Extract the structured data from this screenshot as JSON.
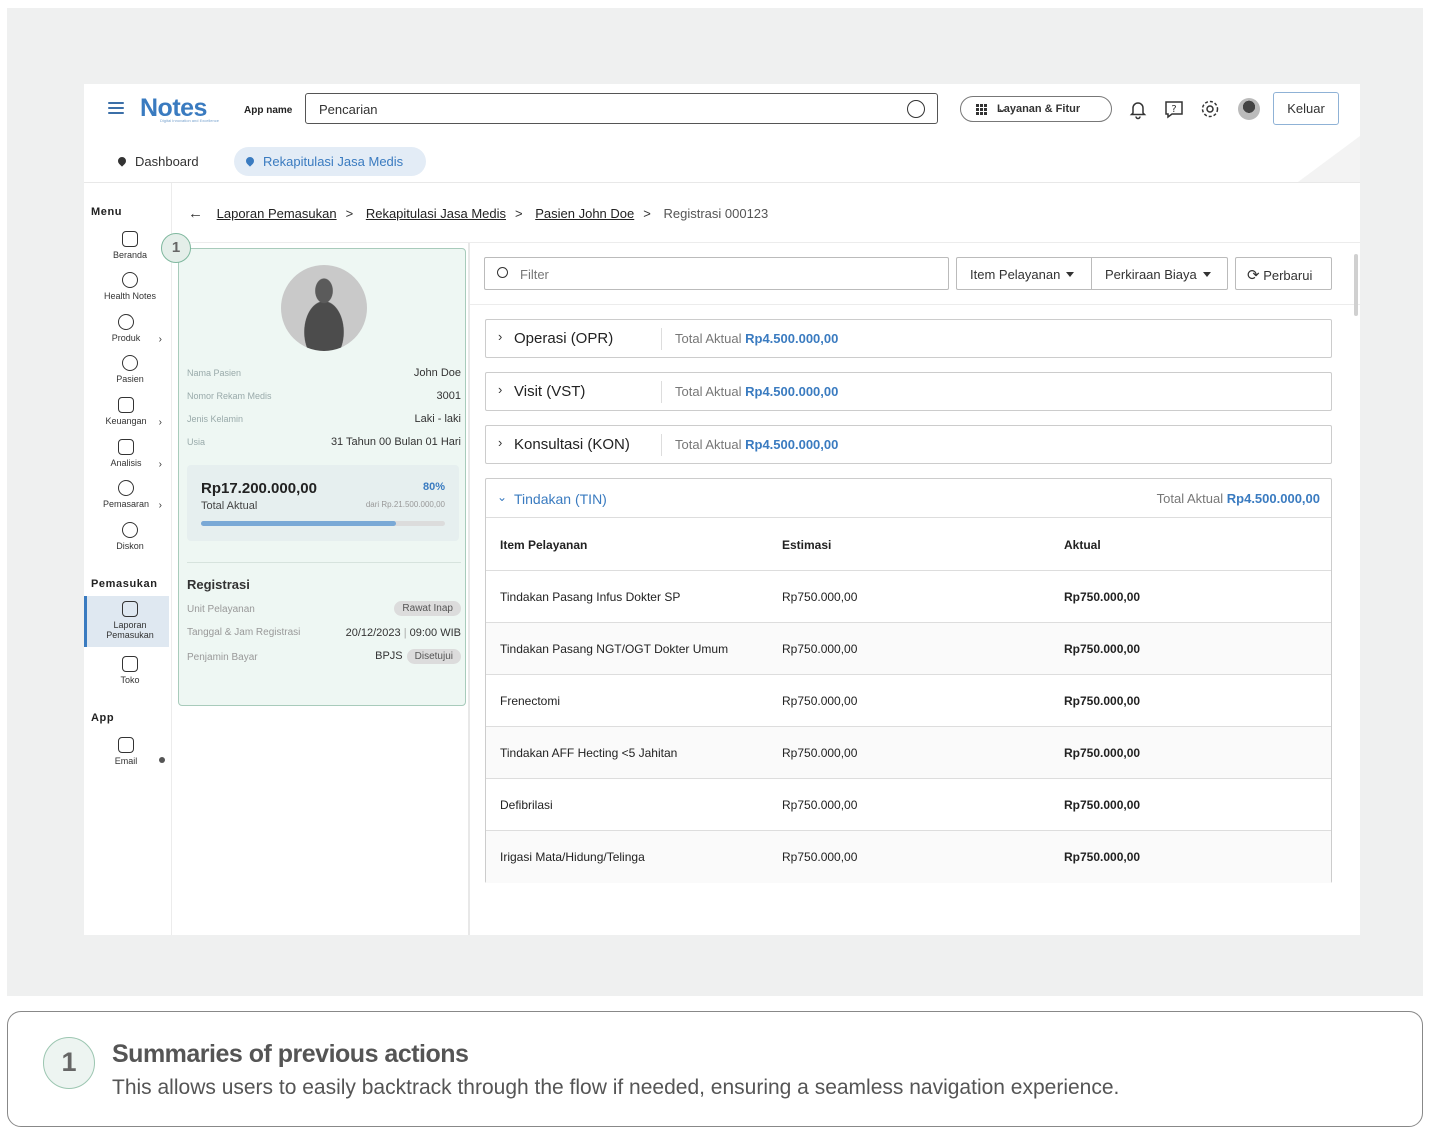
{
  "header": {
    "logo": "Notes",
    "logo_tagline": "Digital Innovation and Excellence",
    "app_name": "App name",
    "search_text": "Pencarian",
    "services_label": "Layanan & Fitur",
    "logout_label": "Keluar",
    "icons": [
      "menu-icon",
      "bell-icon",
      "help-icon",
      "gear-icon",
      "avatar"
    ]
  },
  "tabs": {
    "dashboard": "Dashboard",
    "active": "Rekapitulasi Jasa Medis"
  },
  "sidebar": {
    "menu_title": "Menu",
    "menu_items": [
      {
        "label": "Beranda",
        "icon": "home-icon"
      },
      {
        "label": "Health Notes",
        "icon": "notes-icon"
      },
      {
        "label": "Produk",
        "icon": "product-icon",
        "has_arrow": true
      },
      {
        "label": "Pasien",
        "icon": "user-icon"
      },
      {
        "label": "Keuangan",
        "icon": "wallet-icon",
        "has_arrow": true
      },
      {
        "label": "Analisis",
        "icon": "chart-icon",
        "has_arrow": true
      },
      {
        "label": "Pemasaran",
        "icon": "network-icon",
        "has_arrow": true
      },
      {
        "label": "Diskon",
        "icon": "discount-icon"
      }
    ],
    "income_title": "Pemasukan",
    "income_items": [
      {
        "label_1": "Laporan",
        "label_2": "Pemasukan",
        "icon": "report-icon",
        "active": true
      },
      {
        "label": "Toko",
        "icon": "store-icon"
      }
    ],
    "app_title": "App",
    "app_items": [
      {
        "label": "Email",
        "icon": "mail-icon",
        "arrow": "●"
      }
    ],
    "arrow": "›"
  },
  "breadcrumb": {
    "items": [
      "Laporan Pemasukan",
      "Rekapitulasi Jasa Medis",
      "Pasien John Doe"
    ],
    "current": "Registrasi 000123",
    "separator": ">"
  },
  "patient": {
    "step_badge": "1",
    "rows": [
      {
        "label": "Nama Pasien",
        "value": "John Doe"
      },
      {
        "label": "Nomor Rekam Medis",
        "value": "3001"
      },
      {
        "label": "Jenis Kelamin",
        "value": "Laki - laki"
      },
      {
        "label": "Usia",
        "value": "31 Tahun 00 Bulan 01 Hari"
      }
    ],
    "total_amount": "Rp17.200.000,00",
    "total_label": "Total Aktual",
    "total_percent": "80%",
    "total_of": "dari Rp.21.500.000,00",
    "progress": 0.8
  },
  "registration": {
    "title": "Registrasi",
    "unit_label": "Unit Pelayanan",
    "unit_value": "Rawat Inap",
    "datetime_label": "Tanggal & Jam Registrasi",
    "date_value": "20/12/2023",
    "time_value": "09:00 WIB",
    "payer_label": "Penjamin Bayar",
    "payer_value": "BPJS",
    "payer_status": "Disetujui"
  },
  "toolbar": {
    "filter_placeholder": "Filter",
    "dropdown_1": "Item Pelayanan",
    "dropdown_2": "Perkiraan Biaya",
    "refresh": "Perbarui"
  },
  "accordions": [
    {
      "name": "Operasi (OPR)",
      "total_label": "Total Aktual",
      "total_value": "Rp4.500.000,00"
    },
    {
      "name": "Visit (VST)",
      "total_label": "Total Aktual",
      "total_value": "Rp4.500.000,00"
    },
    {
      "name": "Konsultasi (KON)",
      "total_label": "Total Aktual",
      "total_value": "Rp4.500.000,00"
    }
  ],
  "open_section": {
    "name": "Tindakan (TIN)",
    "total_label": "Total Aktual",
    "total_value": "Rp4.500.000,00",
    "columns": [
      "Item Pelayanan",
      "Estimasi",
      "Aktual"
    ],
    "rows": [
      [
        "Tindakan Pasang Infus Dokter SP",
        "Rp750.000,00",
        "Rp750.000,00"
      ],
      [
        "Tindakan Pasang NGT/OGT Dokter Umum",
        "Rp750.000,00",
        "Rp750.000,00"
      ],
      [
        "Frenectomi",
        "Rp750.000,00",
        "Rp750.000,00"
      ],
      [
        "Tindakan AFF Hecting <5 Jahitan",
        "Rp750.000,00",
        "Rp750.000,00"
      ],
      [
        "Defibrilasi",
        "Rp750.000,00",
        "Rp750.000,00"
      ],
      [
        "Irigasi Mata/Hidung/Telinga",
        "Rp750.000,00",
        "Rp750.000,00"
      ]
    ]
  },
  "footnote": {
    "number": "1",
    "title": "Summaries of previous actions",
    "description": "This allows users to easily backtrack through the flow if needed, ensuring a seamless navigation experience."
  },
  "colors": {
    "accent": "#3a7bc0",
    "card_bg": "#eef7f3",
    "card_border": "#a8cbbb",
    "stage_bg": "#eff0f0"
  }
}
